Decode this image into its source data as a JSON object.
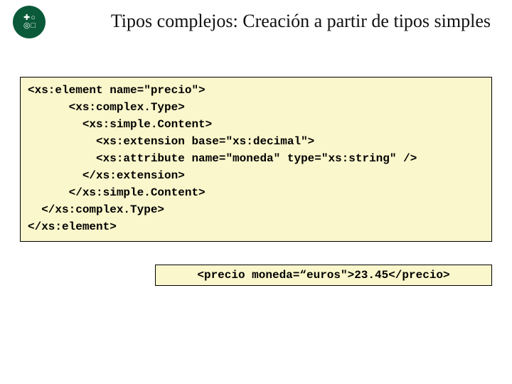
{
  "title": "Tipos complejos: Creación a partir de tipos simples",
  "code": "<xs:element name=\"precio\">\n      <xs:complex.Type>\n        <xs:simple.Content>\n          <xs:extension base=\"xs:decimal\">\n          <xs:attribute name=\"moneda\" type=\"xs:string\" />\n        </xs:extension>\n      </xs:simple.Content>\n  </xs:complex.Type>\n</xs:element>",
  "example": "<precio moneda=“euros\">23.45</precio>"
}
